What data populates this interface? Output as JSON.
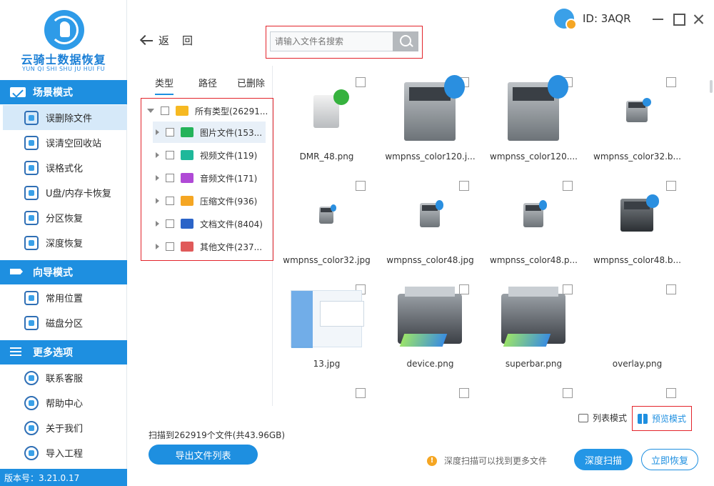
{
  "app": {
    "logo_title": "云骑士数据恢复",
    "logo_subtitle": "YUN QI SHI SHU JU HUI FU",
    "version": "版本号：3.21.0.17",
    "accent_color": "#1e8fe0"
  },
  "sidebar": {
    "sections": [
      {
        "title": "场景模式",
        "icon": "gear-icon",
        "items": [
          {
            "label": "误删除文件",
            "icon": "delete-file-icon",
            "active": true
          },
          {
            "label": "误清空回收站",
            "icon": "recycle-bin-icon"
          },
          {
            "label": "误格式化",
            "icon": "format-icon"
          },
          {
            "label": "U盘/内存卡恢复",
            "icon": "usb-icon"
          },
          {
            "label": "分区恢复",
            "icon": "partition-icon"
          },
          {
            "label": "深度恢复",
            "icon": "deep-recovery-icon"
          }
        ]
      },
      {
        "title": "向导模式",
        "icon": "signpost-icon",
        "items": [
          {
            "label": "常用位置",
            "icon": "windows-icon"
          },
          {
            "label": "磁盘分区",
            "icon": "disk-icon"
          }
        ]
      },
      {
        "title": "更多选项",
        "icon": "menu-icon",
        "items": [
          {
            "label": "联系客服",
            "icon": "phone-icon"
          },
          {
            "label": "帮助中心",
            "icon": "help-icon"
          },
          {
            "label": "关于我们",
            "icon": "info-icon"
          },
          {
            "label": "导入工程",
            "icon": "import-icon"
          }
        ]
      }
    ]
  },
  "topbar": {
    "back_label": "返回",
    "search_placeholder": "请输入文件名搜索",
    "user_id": "ID: 3AQR"
  },
  "tree": {
    "tabs": [
      "类型",
      "路径",
      "已删除"
    ],
    "rows": [
      {
        "label": "所有类型(26291...",
        "icon": "folder-icon",
        "color": "#f6b922",
        "expanded": true
      },
      {
        "label": "图片文件(153...",
        "icon": "image-file-icon",
        "color": "#25b35a",
        "selected": true
      },
      {
        "label": "视频文件(119)",
        "icon": "video-file-icon",
        "color": "#1fb89a"
      },
      {
        "label": "音频文件(171)",
        "icon": "audio-file-icon",
        "color": "#b04ad6"
      },
      {
        "label": "压缩文件(936)",
        "icon": "zip-file-icon",
        "color": "#f5a623"
      },
      {
        "label": "文档文件(8404)",
        "icon": "document-file-icon",
        "color": "#2b64c8"
      },
      {
        "label": "其他文件(237...",
        "icon": "other-file-icon",
        "color": "#e05a5a"
      }
    ]
  },
  "files": [
    {
      "name": "DMR_48.png",
      "kind": "dmr"
    },
    {
      "name": "wmpnss_color120.j...",
      "kind": "media-large"
    },
    {
      "name": "wmpnss_color120....",
      "kind": "media-large"
    },
    {
      "name": "wmpnss_color32.b...",
      "kind": "media-small-dark"
    },
    {
      "name": "wmpnss_color32.jpg",
      "kind": "media-small"
    },
    {
      "name": "wmpnss_color48.jpg",
      "kind": "media-medium"
    },
    {
      "name": "wmpnss_color48.p...",
      "kind": "media-medium"
    },
    {
      "name": "wmpnss_color48.b...",
      "kind": "media-medium-dark"
    },
    {
      "name": "13.jpg",
      "kind": "screenshot"
    },
    {
      "name": "device.png",
      "kind": "printer"
    },
    {
      "name": "superbar.png",
      "kind": "printer"
    },
    {
      "name": "overlay.png",
      "kind": "blank"
    }
  ],
  "bottom": {
    "view_list_label": "列表模式",
    "view_preview_label": "预览模式",
    "scan_info": "扫描到262919个文件(共43.96GB)",
    "export_label": "导出文件列表",
    "tip": "深度扫描可以找到更多文件",
    "deep_scan_label": "深度扫描",
    "recover_label": "立即恢复"
  }
}
